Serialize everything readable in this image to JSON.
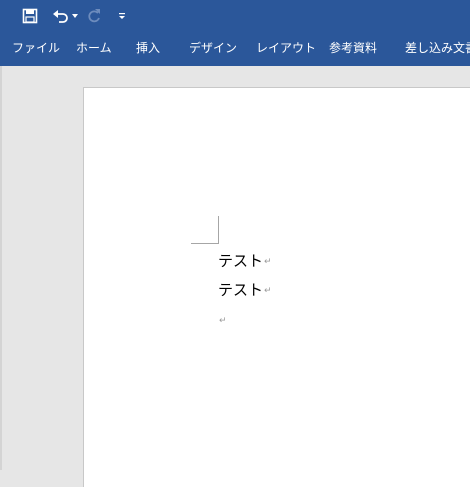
{
  "title_bar": {
    "icons": [
      "save-icon",
      "undo-icon",
      "undo-dropdown-icon",
      "redo-icon",
      "customize-qat-icon"
    ]
  },
  "ribbon": {
    "tabs": [
      {
        "label": "ファイル"
      },
      {
        "label": "ホーム"
      },
      {
        "label": "挿入"
      },
      {
        "label": "デザイン"
      },
      {
        "label": "レイアウト"
      },
      {
        "label": "参考資料"
      },
      {
        "label": "差し込み文書"
      }
    ]
  },
  "document": {
    "paragraphs": [
      {
        "text": "テスト",
        "mark": "↵"
      },
      {
        "text": "テスト",
        "mark": "↵"
      },
      {
        "text": "",
        "mark": "↵"
      }
    ]
  },
  "colors": {
    "ribbon": "#2b579a",
    "canvas": "#e6e6e6",
    "page": "#ffffff"
  }
}
